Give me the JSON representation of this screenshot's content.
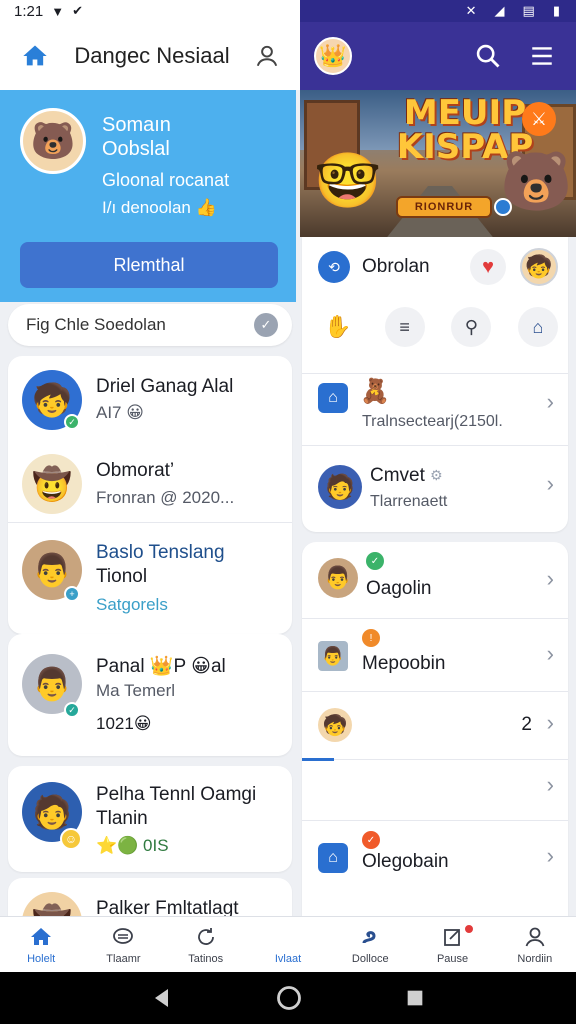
{
  "status_bar": {
    "time": "1:21"
  },
  "left_header": {
    "title": "Dangec Nesiaal"
  },
  "hero": {
    "line1": "Somaın",
    "line2": "Oobslal",
    "line3": "Gloonal rocanat",
    "line4": "I/ı denoolan 👍",
    "button_label": "Rlemthal"
  },
  "banner": {
    "title_line1": "MEUIP",
    "title_line2": "KISPAP",
    "pill_label": "RIONRUR"
  },
  "search": {
    "text": "Fig Chle Soedolan"
  },
  "contacts": [
    {
      "name": "Driel Ganag Alal",
      "sub": "AI7 😀"
    },
    {
      "name": "Obmorat’",
      "sub": "Fronran @ 2020..."
    },
    {
      "name": "Baslo Tenslang",
      "name2": "Tionol",
      "sub": "Satgorels"
    },
    {
      "name": "Panal 👑P 😀al",
      "sub": "Ma Temerl",
      "sub2": "1021😀"
    },
    {
      "name": "Pelha Tennl Oamgi",
      "name2": "Tlanin",
      "sub": "⭐🟢 0IS"
    },
    {
      "name": "Palker Fmltatlagt"
    }
  ],
  "right_panel": {
    "chat_label": "Obrolan",
    "row1_sub": "Tralnsectearj(2150l.",
    "row2_name": "Cmvet",
    "row2_sub": "Tlarrenaett",
    "list": [
      {
        "label": "Oagolin"
      },
      {
        "label": "Mepoobin"
      },
      {
        "label": "",
        "count": "2"
      },
      {
        "label": ""
      },
      {
        "label": "Olegobain"
      }
    ]
  },
  "bottom_nav": [
    {
      "label": "Holelt"
    },
    {
      "label": "Tlaamr"
    },
    {
      "label": "Tatinos"
    },
    {
      "label": "Ivlaat"
    },
    {
      "label": "Dolloce"
    },
    {
      "label": "Pause"
    },
    {
      "label": "Nordiin"
    }
  ],
  "colors": {
    "accent": "#2a6fd0",
    "hero_bg": "#4db0ee",
    "header_right": "#3a3296"
  }
}
